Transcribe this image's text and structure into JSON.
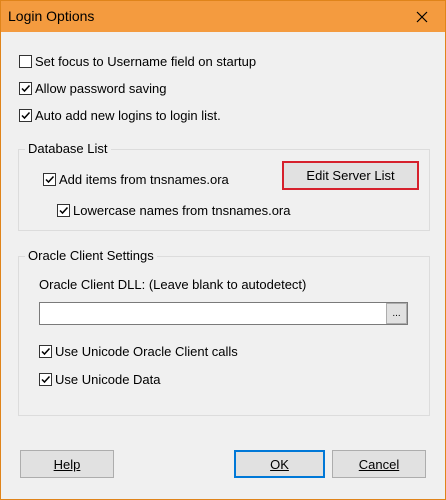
{
  "window": {
    "title": "Login Options"
  },
  "general": {
    "set_focus": {
      "label": "Set focus to Username field on startup",
      "checked": false
    },
    "allow_password": {
      "label": "Allow password saving",
      "checked": true
    },
    "auto_add": {
      "label": "Auto add new logins to login list.",
      "checked": true
    }
  },
  "database_list": {
    "title": "Database List",
    "add_items": {
      "label": "Add items from tnsnames.ora",
      "checked": true
    },
    "edit_server_list": "Edit Server List",
    "lowercase": {
      "label": "Lowercase names from tnsnames.ora",
      "checked": true
    }
  },
  "oracle_client": {
    "title": "Oracle Client Settings",
    "dll_label": "Oracle Client DLL: (Leave blank to autodetect)",
    "dll_value": "",
    "browse_label": "...",
    "unicode_calls": {
      "label": "Use Unicode Oracle Client calls",
      "checked": true
    },
    "unicode_data": {
      "label": "Use Unicode Data",
      "checked": true
    }
  },
  "buttons": {
    "help": "Help",
    "ok": "OK",
    "cancel": "Cancel"
  },
  "colors": {
    "titlebar": "#f49b3f",
    "highlight_border": "#d6202c",
    "default_border": "#0078d7"
  }
}
